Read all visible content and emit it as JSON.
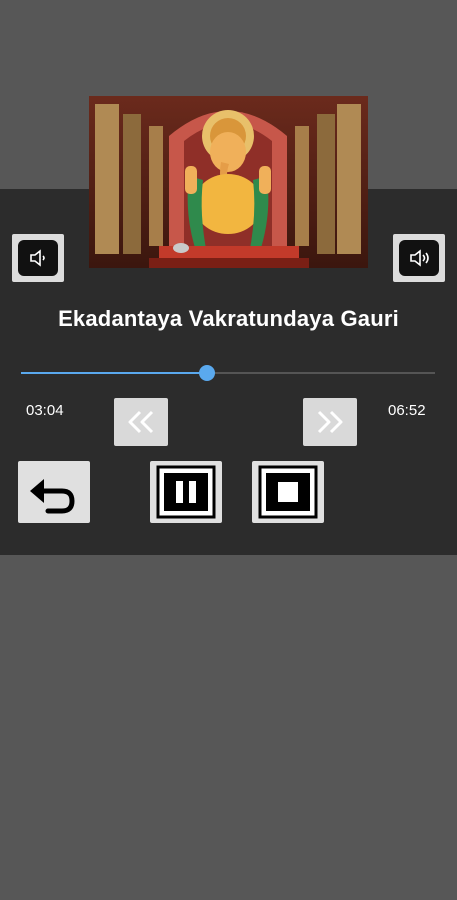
{
  "player": {
    "song_title": "Ekadantaya Vakratundaya Gauri",
    "current_time": "03:04",
    "total_time": "06:52",
    "progress_percent": 45
  },
  "icons": {
    "volume_left": "speaker-icon",
    "volume_right": "speaker-icon",
    "rewind": "double-chevron-left-icon",
    "fast_forward": "double-chevron-right-icon",
    "back": "undo-arrow-icon",
    "pause": "pause-icon",
    "stop": "stop-icon"
  },
  "colors": {
    "accent": "#5aa9ee",
    "panel": "#2c2c2c",
    "background": "#575757"
  }
}
